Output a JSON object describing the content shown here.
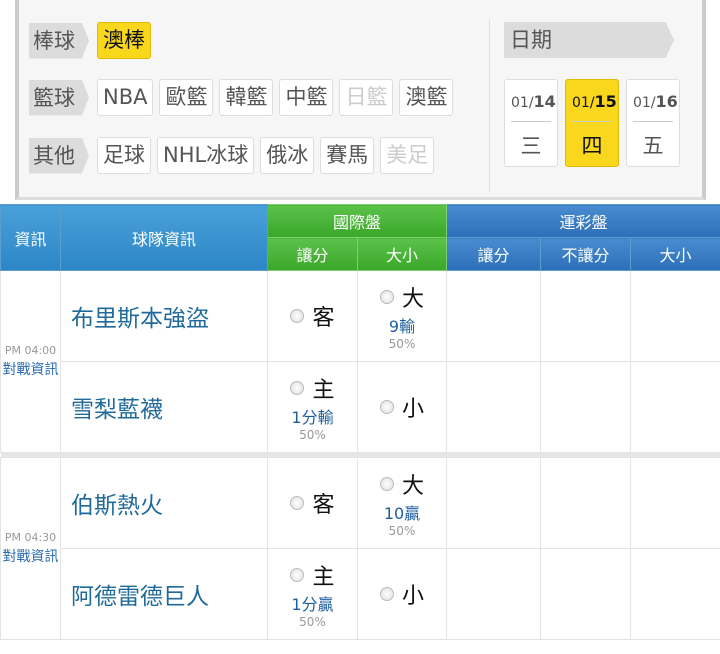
{
  "filters": {
    "baseball": {
      "label": "棒球",
      "items": [
        {
          "label": "澳棒",
          "state": "selected"
        }
      ]
    },
    "basketball": {
      "label": "籃球",
      "items": [
        {
          "label": "NBA",
          "state": "normal"
        },
        {
          "label": "歐籃",
          "state": "normal"
        },
        {
          "label": "韓籃",
          "state": "normal"
        },
        {
          "label": "中籃",
          "state": "normal"
        },
        {
          "label": "日籃",
          "state": "disabled"
        },
        {
          "label": "澳籃",
          "state": "normal"
        }
      ]
    },
    "other": {
      "label": "其他",
      "items": [
        {
          "label": "足球",
          "state": "normal"
        },
        {
          "label": "NHL冰球",
          "state": "normal"
        },
        {
          "label": "俄冰",
          "state": "normal"
        },
        {
          "label": "賽馬",
          "state": "normal"
        },
        {
          "label": "美足",
          "state": "disabled"
        }
      ]
    }
  },
  "dates": {
    "label": "日期",
    "items": [
      {
        "month": "01/",
        "day": "14",
        "weekday": "三"
      },
      {
        "month": "01/",
        "day": "15",
        "weekday": "四",
        "selected": true
      },
      {
        "month": "01/",
        "day": "16",
        "weekday": "五"
      }
    ]
  },
  "table": {
    "headers": {
      "info": "資訊",
      "team": "球隊資訊",
      "intl": "國際盤",
      "sport": "運彩盤",
      "intl_spread": "讓分",
      "intl_total": "大小",
      "sport_spread": "讓分",
      "sport_nospread": "不讓分",
      "sport_total": "大小"
    },
    "games": [
      {
        "time": "PM 04:00",
        "link": "對戰資訊",
        "away": "布里斯本強盜",
        "home": "雪梨藍襪",
        "away_spread": "客",
        "home_spread": "主",
        "home_line": "1分輸",
        "home_pct": "50%",
        "over": "大",
        "over_line": "9輸",
        "over_pct": "50%",
        "under": "小"
      },
      {
        "time": "PM 04:30",
        "link": "對戰資訊",
        "away": "伯斯熱火",
        "home": "阿德雷德巨人",
        "away_spread": "客",
        "home_spread": "主",
        "home_line": "1分贏",
        "home_pct": "50%",
        "over": "大",
        "over_line": "10贏",
        "over_pct": "50%",
        "under": "小"
      }
    ]
  }
}
